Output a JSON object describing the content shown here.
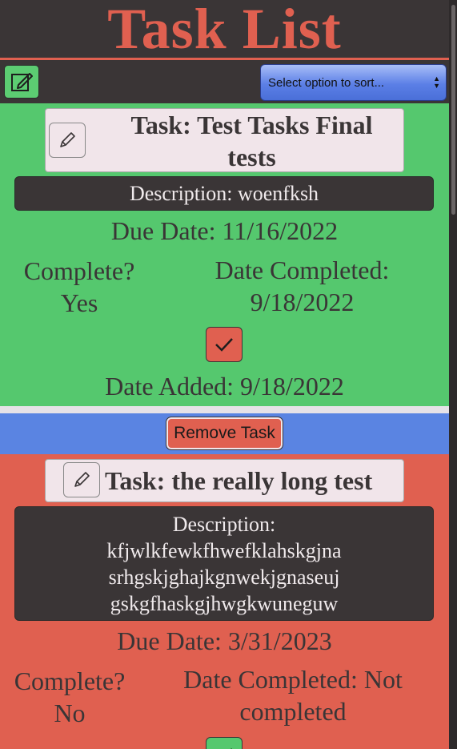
{
  "header": {
    "title": "Task List"
  },
  "toolbar": {
    "sort_placeholder": "Select option to sort..."
  },
  "tasks": [
    {
      "title": "Task: Test Tasks Final tests",
      "description": "Description: woenfksh",
      "due": "Due Date: 11/16/2022",
      "complete_label": "Complete?",
      "complete_value": "Yes",
      "completed_label": "Date Completed:",
      "completed_value": "9/18/2022",
      "added": "Date Added: 9/18/2022",
      "color": "#55c86e"
    },
    {
      "title": "Task: the really long test",
      "description_label": "Description:",
      "description_lines": [
        "kfjwlkfewkfhwefklahskgjna",
        "srhgskjghajkgnwekjgnaseuj",
        "gskgfhaskgjhwgkwuneguw"
      ],
      "due": "Due Date: 3/31/2023",
      "complete_label": "Complete?",
      "complete_value": "No",
      "completed_label": "Date Completed: Not",
      "completed_value": "completed",
      "color": "#e06050"
    }
  ],
  "actions": {
    "remove_label": "Remove Task"
  },
  "colors": {
    "accent_red": "#e06050",
    "done_green": "#55c86e",
    "sort_blue": "#5a84e2",
    "dark": "#3a3536"
  }
}
